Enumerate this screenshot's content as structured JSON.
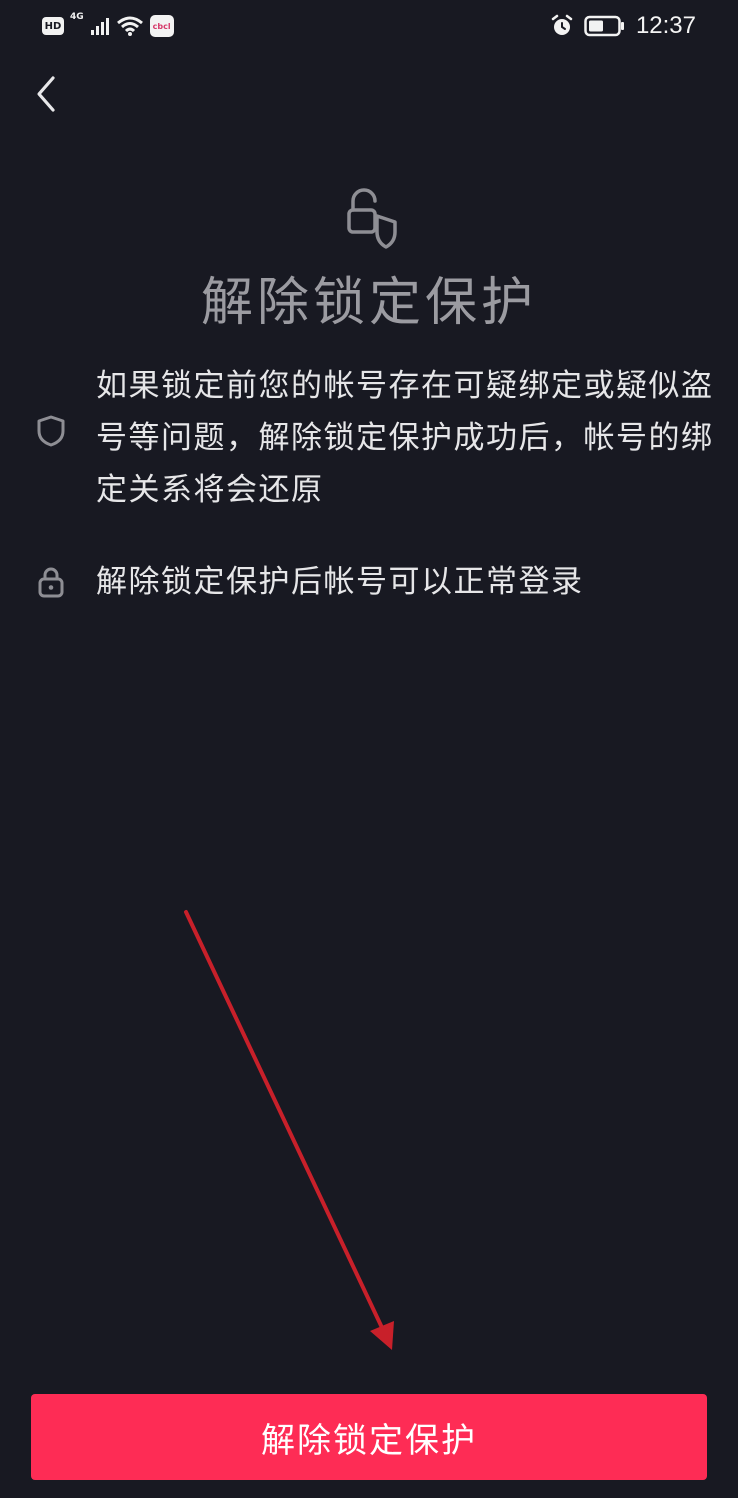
{
  "status_bar": {
    "hd_label": "HD",
    "network_type": "4G",
    "app_badge": "cbcl",
    "time": "12:37",
    "icons": [
      "signal-icon",
      "wifi-icon",
      "alarm-icon",
      "battery-icon"
    ]
  },
  "header": {
    "back_icon": "chevron-left-icon"
  },
  "hero": {
    "icon": "lock-shield-icon",
    "title": "解除锁定保护"
  },
  "info_items": [
    {
      "icon": "shield-icon",
      "text": "如果锁定前您的帐号存在可疑绑定或疑似盗号等问题，解除锁定保护成功后，帐号的绑定关系将会还原"
    },
    {
      "icon": "lock-icon",
      "text": "解除锁定保护后帐号可以正常登录"
    }
  ],
  "footer": {
    "button_label": "解除锁定保护"
  },
  "colors": {
    "background": "#181922",
    "accent": "#fe2c55",
    "title_gray": "#9b9ba1",
    "annotation_red": "#c8202a"
  }
}
